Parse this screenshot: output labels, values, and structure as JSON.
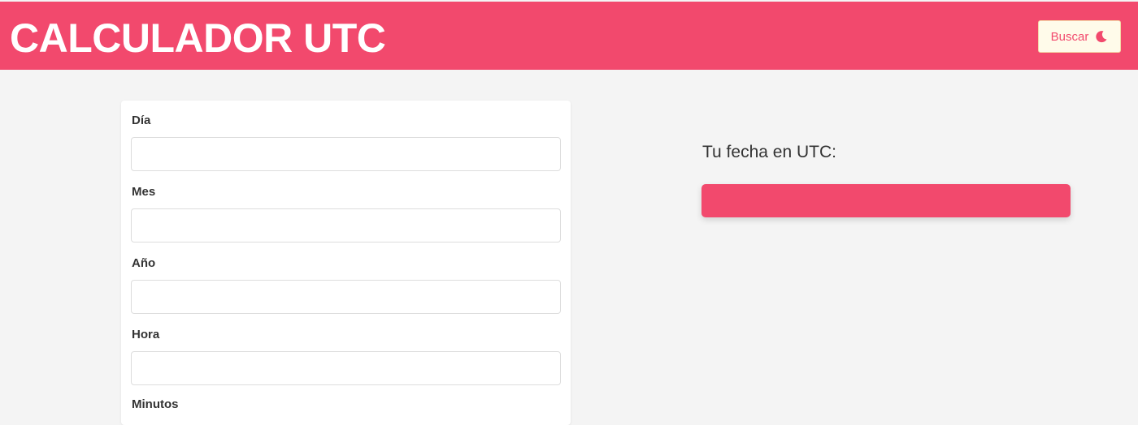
{
  "header": {
    "title": "CALCULADOR UTC",
    "search_button_label": "Buscar",
    "search_button_icon": "moon-icon"
  },
  "form": {
    "fields": [
      {
        "label": "Día",
        "value": "",
        "placeholder": ""
      },
      {
        "label": "Mes",
        "value": "",
        "placeholder": ""
      },
      {
        "label": "Año",
        "value": "",
        "placeholder": ""
      },
      {
        "label": "Hora",
        "value": "",
        "placeholder": ""
      },
      {
        "label": "Minutos",
        "value": "",
        "placeholder": ""
      }
    ]
  },
  "result": {
    "heading": "Tu fecha en UTC:",
    "value": ""
  },
  "colors": {
    "brand": "#f2496d",
    "background": "#f4f4f4",
    "button_background": "#fffbea"
  }
}
